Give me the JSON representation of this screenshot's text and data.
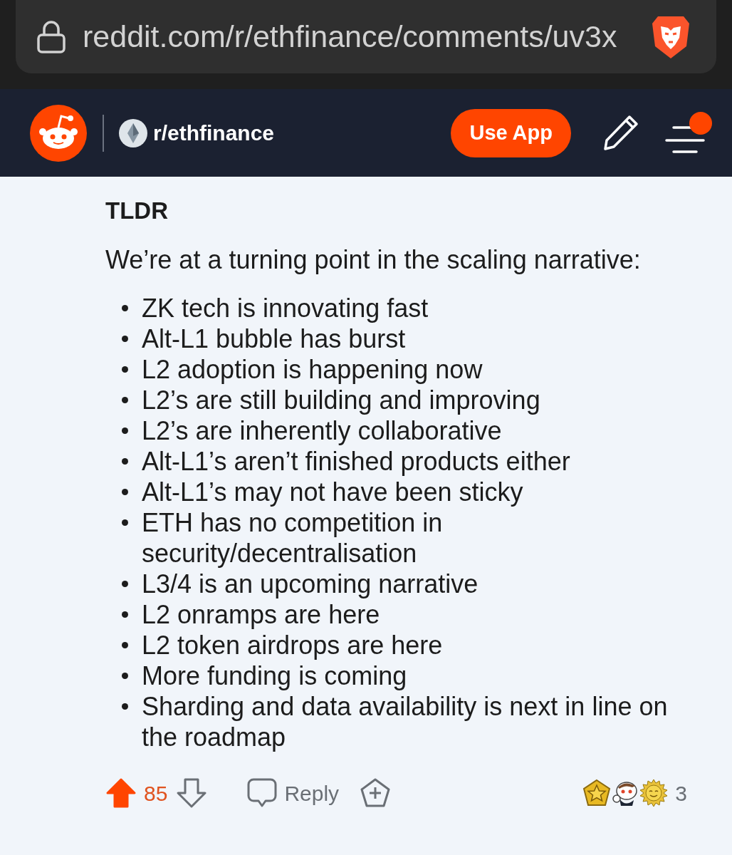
{
  "browser": {
    "url": "reddit.com/r/ethfinance/comments/uv3x"
  },
  "header": {
    "subreddit": "r/ethfinance",
    "use_app": "Use App",
    "menu_has_notification": true
  },
  "comment": {
    "heading": "TLDR",
    "intro": "We’re at a turning point in the scaling narrative:",
    "bullets": [
      "ZK tech is innovating fast",
      "Alt-L1 bubble has burst",
      "L2 adoption is happening now",
      "L2’s are still building and improving",
      "L2’s are inherently collaborative",
      "Alt-L1’s aren’t finished products either",
      "Alt-L1’s may not have been sticky",
      "ETH has no competition in security/decentralisation",
      "L3/4 is an upcoming narrative",
      "L2 onramps are here",
      "L2 token airdrops are here",
      "More funding is coming",
      "Sharding and data availability is next in line on the roadmap"
    ]
  },
  "actions": {
    "score": "85",
    "upvoted": true,
    "reply": "Reply",
    "award_count": "3"
  }
}
